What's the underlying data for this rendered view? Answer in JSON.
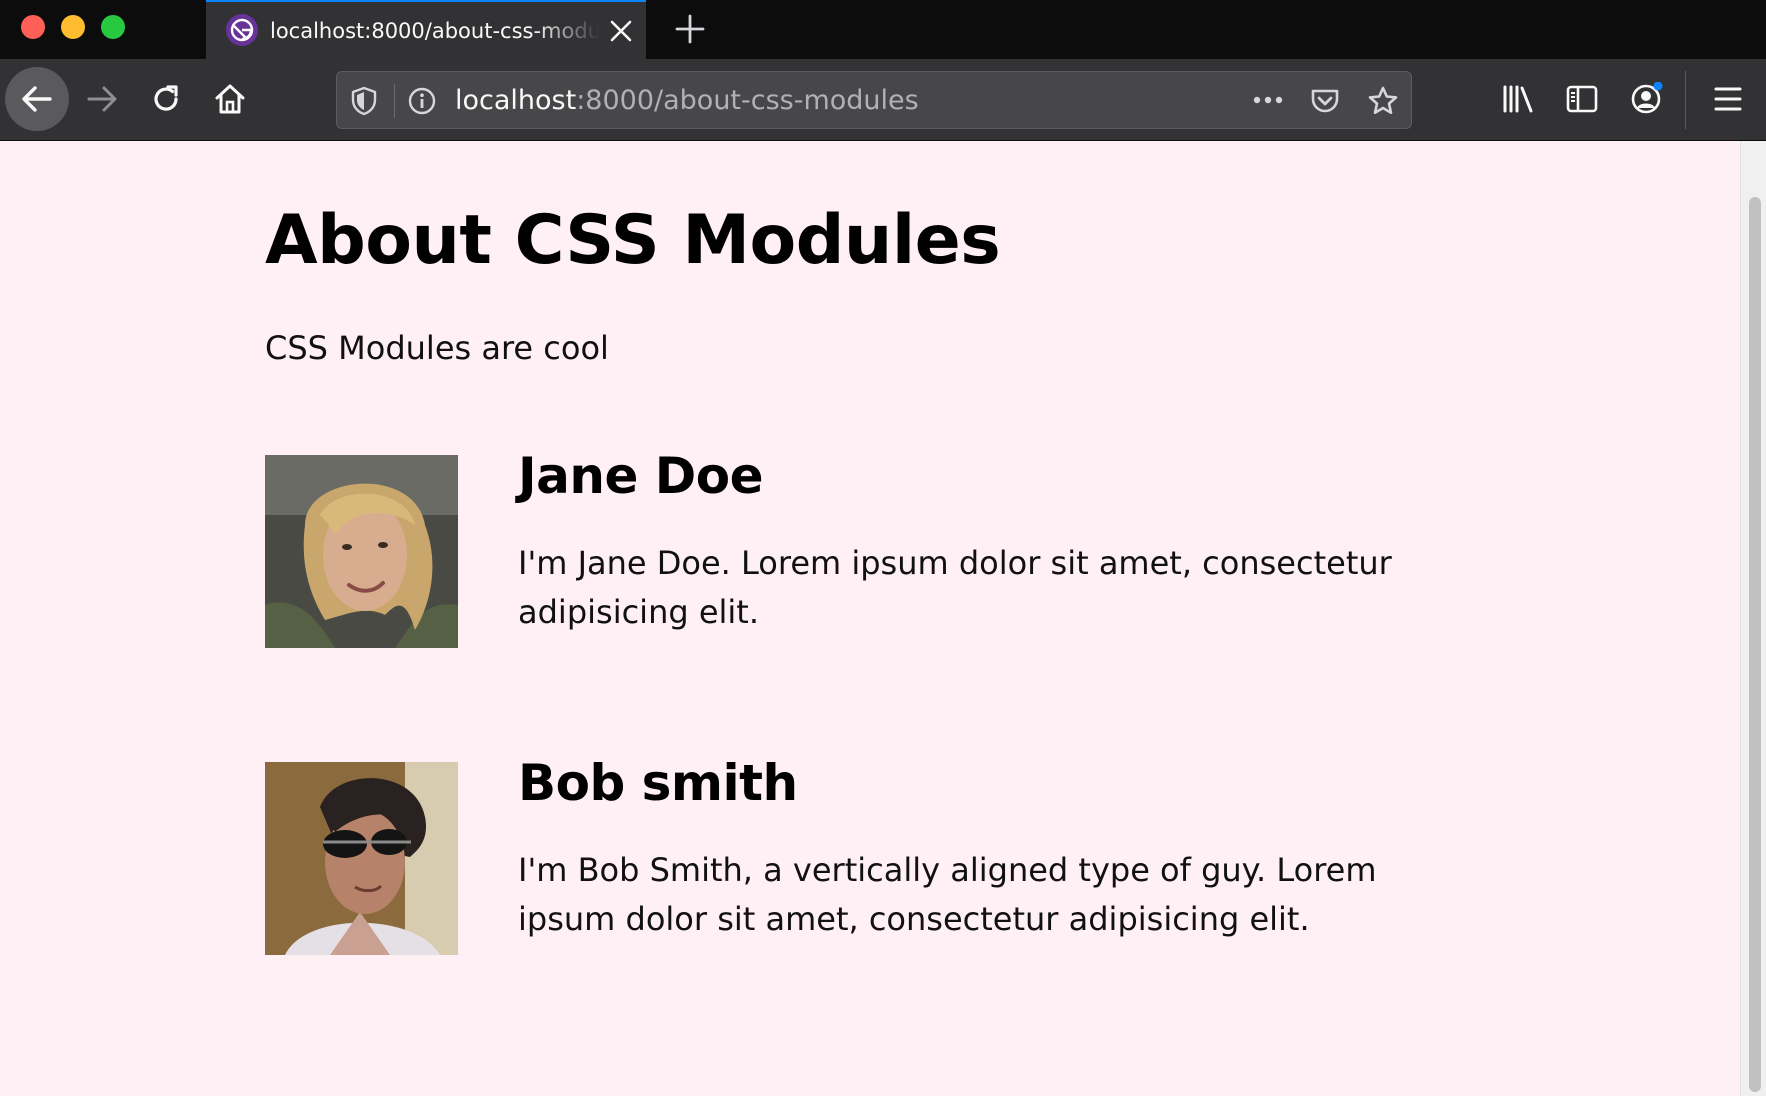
{
  "browser": {
    "tab": {
      "title": "localhost:8000/about-css-modules",
      "favicon": "gatsby-logo-icon"
    },
    "url": {
      "host": "localhost",
      "path": ":8000/about-css-modules"
    },
    "accent_color": "#0a84ff"
  },
  "page": {
    "title": "About CSS Modules",
    "intro": "CSS Modules are cool",
    "background": "#fff0f5",
    "users": [
      {
        "name": "Jane Doe",
        "excerpt": "I'm Jane Doe. Lorem ipsum dolor sit amet, consectetur adipisicing elit.",
        "avatar": "avatar-photo-jane"
      },
      {
        "name": "Bob smith",
        "excerpt": "I'm Bob Smith, a vertically aligned type of guy. Lorem ipsum dolor sit amet, consectetur adipisicing elit.",
        "avatar": "avatar-photo-bob"
      }
    ]
  }
}
